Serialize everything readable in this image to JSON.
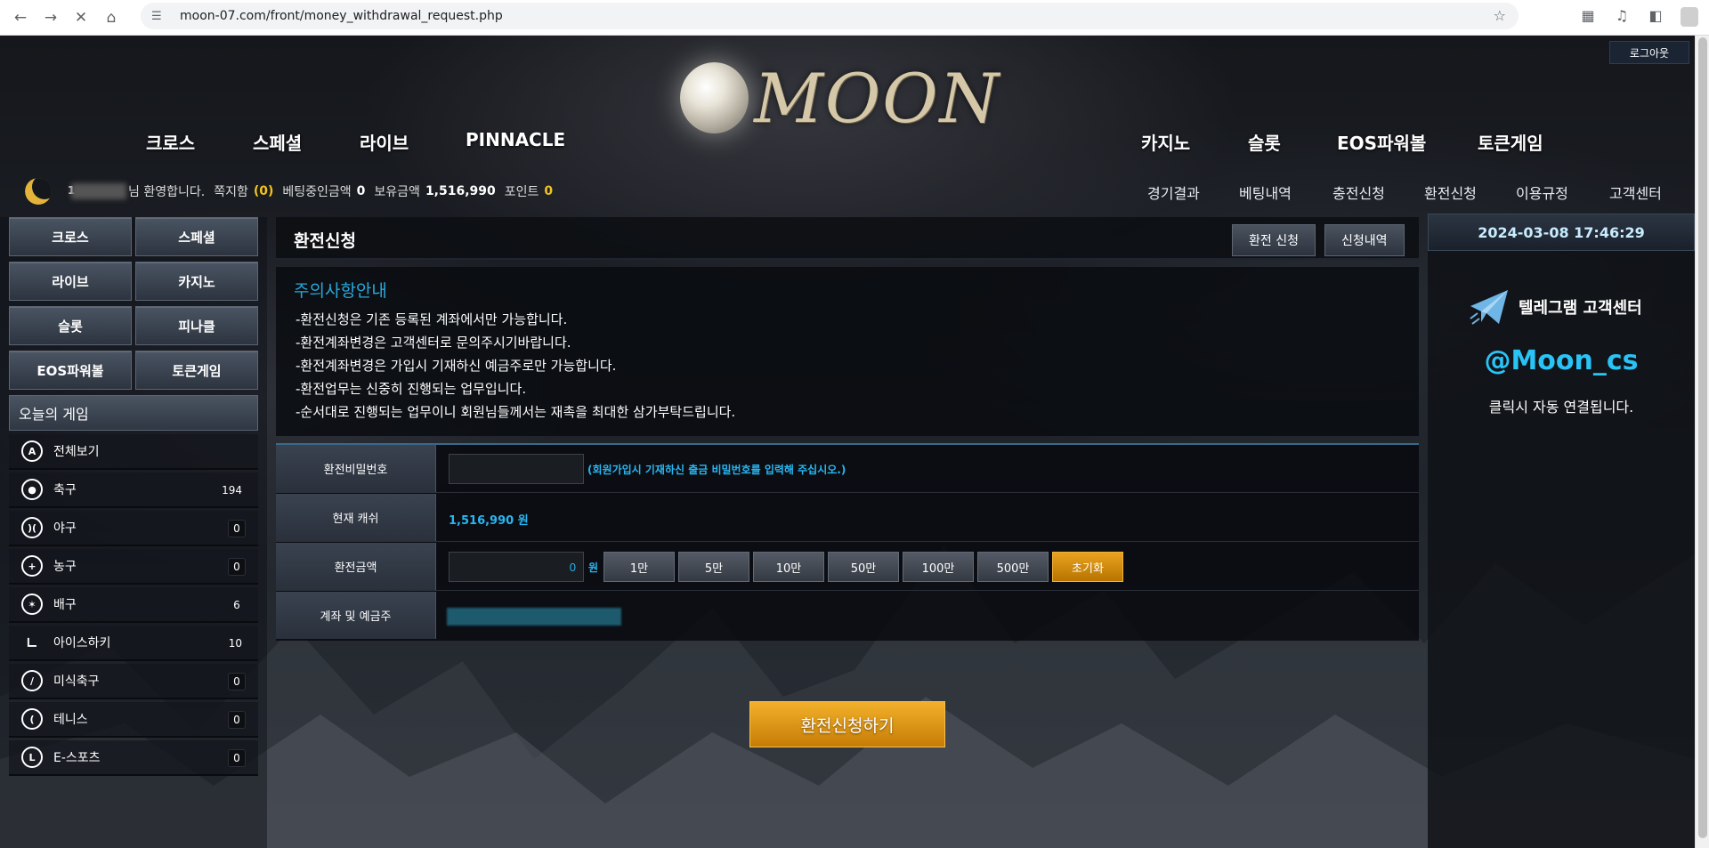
{
  "browser": {
    "url": "moon-07.com/front/money_withdrawal_request.php"
  },
  "header": {
    "logout": "로그아웃",
    "logo_text": "MOON",
    "main_nav_left": [
      "크로스",
      "스페셜",
      "라이브",
      "PINNACLE"
    ],
    "main_nav_right": [
      "카지노",
      "슬롯",
      "EOS파워볼",
      "토큰게임"
    ]
  },
  "userbar": {
    "level": "1",
    "welcome": "님 환영합니다.",
    "message_label": "쪽지함",
    "message_count": "(0)",
    "betting_label": "베팅중인금액",
    "betting_value": "0",
    "balance_label": "보유금액",
    "balance_value": "1,516,990",
    "point_label": "포인트",
    "point_value": "0"
  },
  "sub_nav": [
    "경기결과",
    "베팅내역",
    "충전신청",
    "환전신청",
    "이용규정",
    "고객센터"
  ],
  "sidebar": {
    "games": [
      "크로스",
      "스페셜",
      "라이브",
      "카지노",
      "슬롯",
      "피나클",
      "EOS파워볼",
      "토큰게임"
    ],
    "today_title": "오늘의 게임",
    "sports": [
      {
        "name": "전체보기",
        "count": "",
        "icon": "all-icon"
      },
      {
        "name": "축구",
        "count": "194",
        "icon": "soccer-icon"
      },
      {
        "name": "야구",
        "count": "0",
        "icon": "baseball-icon"
      },
      {
        "name": "농구",
        "count": "0",
        "icon": "basketball-icon"
      },
      {
        "name": "배구",
        "count": "6",
        "icon": "volleyball-icon"
      },
      {
        "name": "아이스하키",
        "count": "10",
        "icon": "hockey-icon"
      },
      {
        "name": "미식축구",
        "count": "0",
        "icon": "football-icon"
      },
      {
        "name": "테니스",
        "count": "0",
        "icon": "tennis-icon"
      },
      {
        "name": "E-스포츠",
        "count": "0",
        "icon": "esports-icon"
      }
    ]
  },
  "main": {
    "title": "환전신청",
    "tab_request": "환전 신청",
    "tab_history": "신청내역",
    "notice_title": "주의사항안내",
    "notice_lines": [
      "-환전신청은 기존 등록된 계좌에서만 가능합니다.",
      "-환전계좌변경은 고객센터로 문의주시기바랍니다.",
      "-환전계좌변경은 가입시 기재하신 예금주로만 가능합니다.",
      "-환전업무는 신중히 진행되는 업무입니다.",
      "-순서대로 진행되는 업무이니 회원님들께서는 재촉을 최대한 삼가부탁드립니다."
    ],
    "form": {
      "password_label": "환전비밀번호",
      "password_hint": "(회원가입시 기재하신 출금 비밀번호를 입력해 주십시오.)",
      "cash_label": "현재 캐쉬",
      "cash_value": "1,516,990 원",
      "amount_label": "환전금액",
      "amount_value": "0",
      "won": "원",
      "amount_buttons": [
        "1만",
        "5만",
        "10만",
        "50만",
        "100만",
        "500만"
      ],
      "reset": "초기화",
      "account_label": "계좌 및 예금주"
    },
    "submit": "환전신청하기"
  },
  "right": {
    "datetime": "2024-03-08 17:46:29",
    "telegram_title": "텔레그램 고객센터",
    "telegram_handle": "@Moon_cs",
    "telegram_sub": "클릭시 자동 연결됩니다."
  }
}
